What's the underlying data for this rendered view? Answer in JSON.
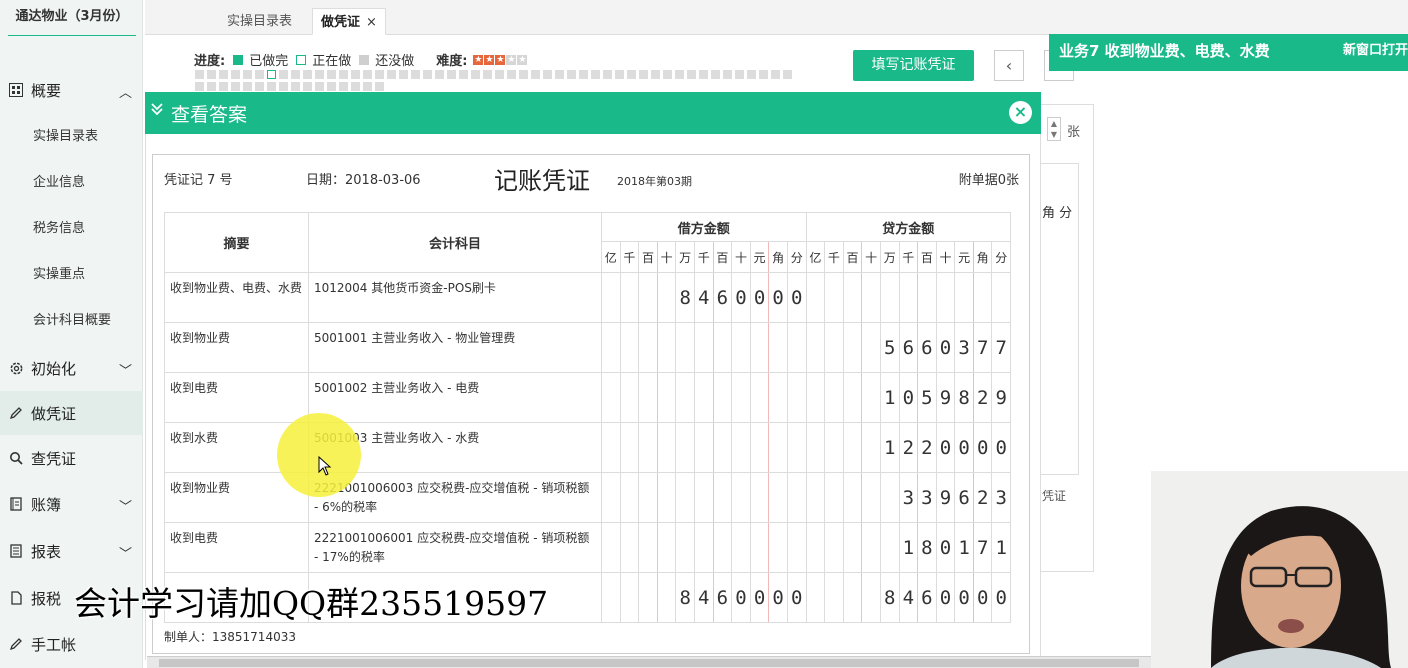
{
  "sidebar": {
    "company": "通达物业（3月份）",
    "sections": [
      {
        "label": "概要",
        "icon": "grid-icon",
        "expanded": true
      },
      {
        "label": "初始化",
        "icon": "gear-icon",
        "expanded": false
      },
      {
        "label": "做凭证",
        "icon": "pen-icon",
        "active": true
      },
      {
        "label": "查凭证",
        "icon": "search-icon"
      },
      {
        "label": "账簿",
        "icon": "book-icon",
        "expanded": false
      },
      {
        "label": "报表",
        "icon": "report-icon",
        "expanded": false
      },
      {
        "label": "报税",
        "icon": "file-icon"
      },
      {
        "label": "手工帐",
        "icon": "pen-icon"
      }
    ],
    "sub_items": [
      "实操目录表",
      "企业信息",
      "税务信息",
      "实操重点",
      "会计科目概要"
    ]
  },
  "tabs": [
    {
      "label": "实操目录表"
    },
    {
      "label": "做凭证",
      "active": true,
      "close": "×"
    }
  ],
  "progress": {
    "label": "进度:",
    "done": "已做完",
    "doing": "正在做",
    "todo": "还没做",
    "difficulty_label": "难度:",
    "difficulty": 3,
    "difficulty_max": 5
  },
  "toolbar": {
    "fill_button": "填写记账凭证",
    "prev": "‹"
  },
  "task": {
    "title": "业务7 收到物业费、电费、水费",
    "new_window": "新窗口打开"
  },
  "background_form": {
    "unit": "张",
    "jiao": "角",
    "fen": "分",
    "label": "凭证"
  },
  "modal": {
    "title": "查看答案",
    "close": "×"
  },
  "voucher": {
    "number": "凭证记 7 号",
    "date": "日期：2018-03-06",
    "title": "记账凭证",
    "period": "2018年第03期",
    "attachments": "附单据0张",
    "maker": "制单人：13851714033",
    "headers": {
      "summary": "摘要",
      "account": "会计科目",
      "debit": "借方金额",
      "credit": "贷方金额",
      "digits": [
        "亿",
        "千",
        "百",
        "十",
        "万",
        "千",
        "百",
        "十",
        "元",
        "角",
        "分"
      ]
    },
    "rows": [
      {
        "summary": "收到物业费、电费、水费",
        "account": "1012004 其他货币资金-POS刷卡",
        "debit": "8460000",
        "credit": ""
      },
      {
        "summary": "收到物业费",
        "account": "5001001 主营业务收入 - 物业管理费",
        "debit": "",
        "credit": "5660377"
      },
      {
        "summary": "收到电费",
        "account": "5001002 主营业务收入 - 电费",
        "debit": "",
        "credit": "1059829"
      },
      {
        "summary": "收到水费",
        "account": "5001003 主营业务收入 - 水费",
        "debit": "",
        "credit": "1220000"
      },
      {
        "summary": "收到物业费",
        "account": "2221001006003 应交税费-应交增值税 - 销项税额 - 6%的税率",
        "debit": "",
        "credit": "339623"
      },
      {
        "summary": "收到电费",
        "account": "2221001006001 应交税费-应交增值税 - 销项税额 - 17%的税率",
        "debit": "",
        "credit": "180171"
      }
    ],
    "total": {
      "debit": "8460000",
      "credit": "8460000"
    }
  },
  "watermark": "会计学习请加QQ群235519597"
}
